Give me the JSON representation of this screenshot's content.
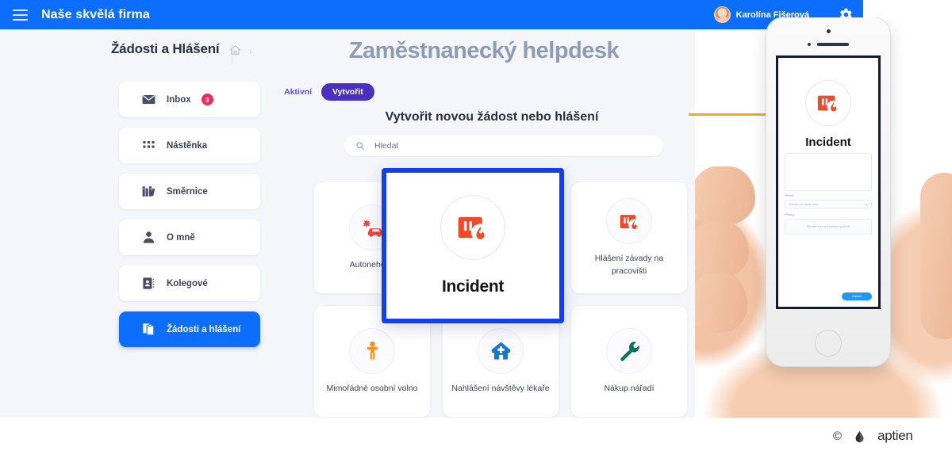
{
  "topbar": {
    "menu_icon": "hamburger-icon",
    "brand": "Naše skvělá firma",
    "user_name": "Karolína Fišerová",
    "settings_icon": "gear-icon"
  },
  "sidebar": {
    "title": "Žádosti a Hlášení",
    "breadcrumb": {
      "home_icon": "home-icon",
      "separator": "›"
    },
    "items": [
      {
        "label": "Inbox",
        "icon": "envelope-icon",
        "badge": "3",
        "active": false
      },
      {
        "label": "Nástěnka",
        "icon": "grid-dots-icon",
        "badge": "",
        "active": false
      },
      {
        "label": "Směrnice",
        "icon": "books-icon",
        "badge": "",
        "active": false
      },
      {
        "label": "O mně",
        "icon": "person-icon",
        "badge": "",
        "active": false
      },
      {
        "label": "Kolegové",
        "icon": "contact-card-icon",
        "badge": "",
        "active": false
      },
      {
        "label": "Žádosti a hlášení",
        "icon": "clipboard-copy-icon",
        "badge": "",
        "active": true
      }
    ]
  },
  "main": {
    "page_title": "Zaměstnanecký helpdesk",
    "tabs": [
      {
        "label": "Aktivní",
        "selected": false
      },
      {
        "label": "Vytvořit",
        "selected": true
      }
    ],
    "section_title": "Vytvořit novou žádost nebo hlášení",
    "search": {
      "placeholder": "Hledat",
      "value": "",
      "icon": "search-icon"
    },
    "tiles": [
      {
        "label": "Autonehoda",
        "icon": "car-crash-icon",
        "color": "#e8453c"
      },
      {
        "label": "Incident",
        "icon": "incident-fire-icon",
        "color": "#ee4b2b"
      },
      {
        "label": "Hlášení závady na pracovišti",
        "icon": "incident-fire-icon",
        "color": "#ee4b2b"
      },
      {
        "label": "Mimořádné osobní volno",
        "icon": "person-arms-up-icon",
        "color": "#f7941d"
      },
      {
        "label": "Nahlášení návštěvy lékaře",
        "icon": "medical-house-icon",
        "color": "#1878c4"
      },
      {
        "label": "Nákup nářadí",
        "icon": "wrench-icon",
        "color": "#12705f"
      }
    ]
  },
  "highlight": {
    "label": "Incident",
    "icon": "incident-fire-icon",
    "border_color": "#1340e8"
  },
  "phone": {
    "screen_title": "Incident",
    "icon": "incident-fire-icon",
    "fields": [
      {
        "label": "Termín",
        "placeholder": "Klikněte pro výběr data"
      },
      {
        "label": "Přílohy",
        "placeholder": "Klikněte sem pro nahrání souborů"
      }
    ],
    "submit_label": "Odeslat"
  },
  "footer": {
    "copyright": "©",
    "logo_name": "aptien-logo-icon",
    "logo_text": "aptien"
  },
  "colors": {
    "brand_blue": "#0d6efd",
    "highlight_blue": "#1340e8",
    "tab_purple": "#4b2fc0",
    "badge_red": "#f2295b",
    "accent_orange": "#f5a623",
    "app_bg": "#f5f6fa"
  }
}
